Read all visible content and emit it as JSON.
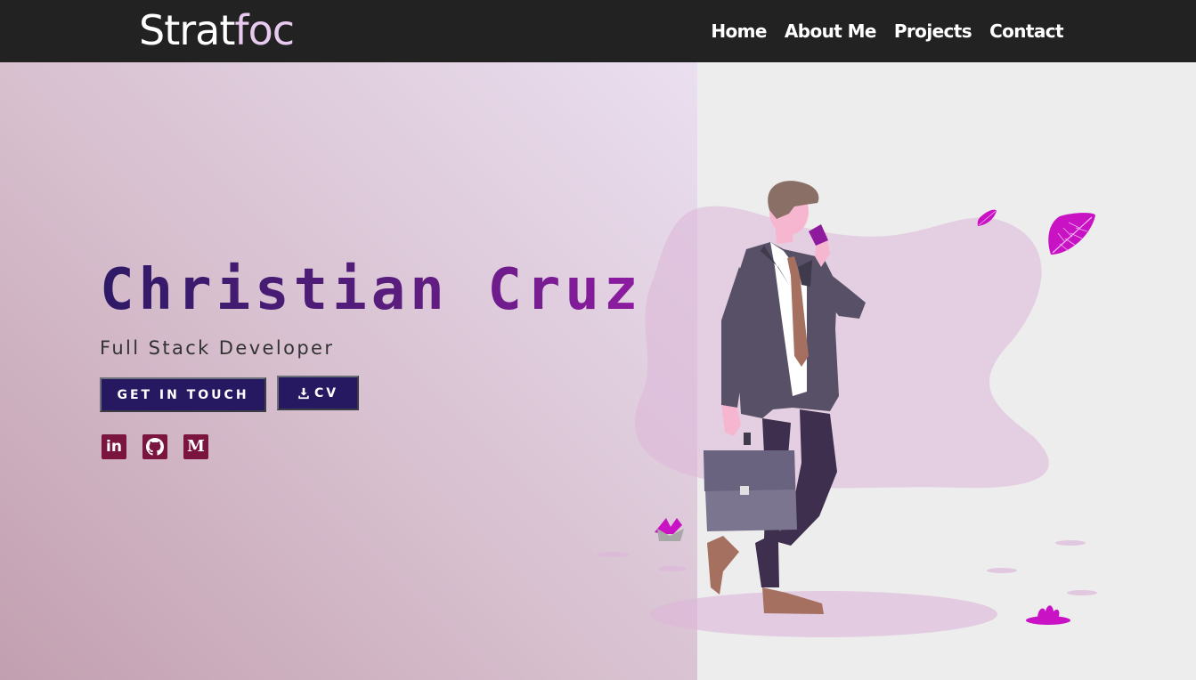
{
  "navbar": {
    "logo_part1": "Strat",
    "logo_part2": "foc",
    "links": [
      {
        "label": "Home"
      },
      {
        "label": "About Me"
      },
      {
        "label": "Projects"
      },
      {
        "label": "Contact"
      }
    ]
  },
  "hero": {
    "name": "Christian Cruz",
    "title": "Full Stack Developer",
    "buttons": {
      "get_in_touch": "GET IN TOUCH",
      "cv": "CV"
    },
    "social": {
      "linkedin": "in",
      "medium": "M"
    }
  },
  "colors": {
    "navbar_bg": "#222222",
    "button_bg": "#261861",
    "social_bg": "#7a1540",
    "accent_magenta": "#c912c4"
  },
  "icons": [
    "download-icon",
    "linkedin-icon",
    "github-icon",
    "medium-icon"
  ]
}
